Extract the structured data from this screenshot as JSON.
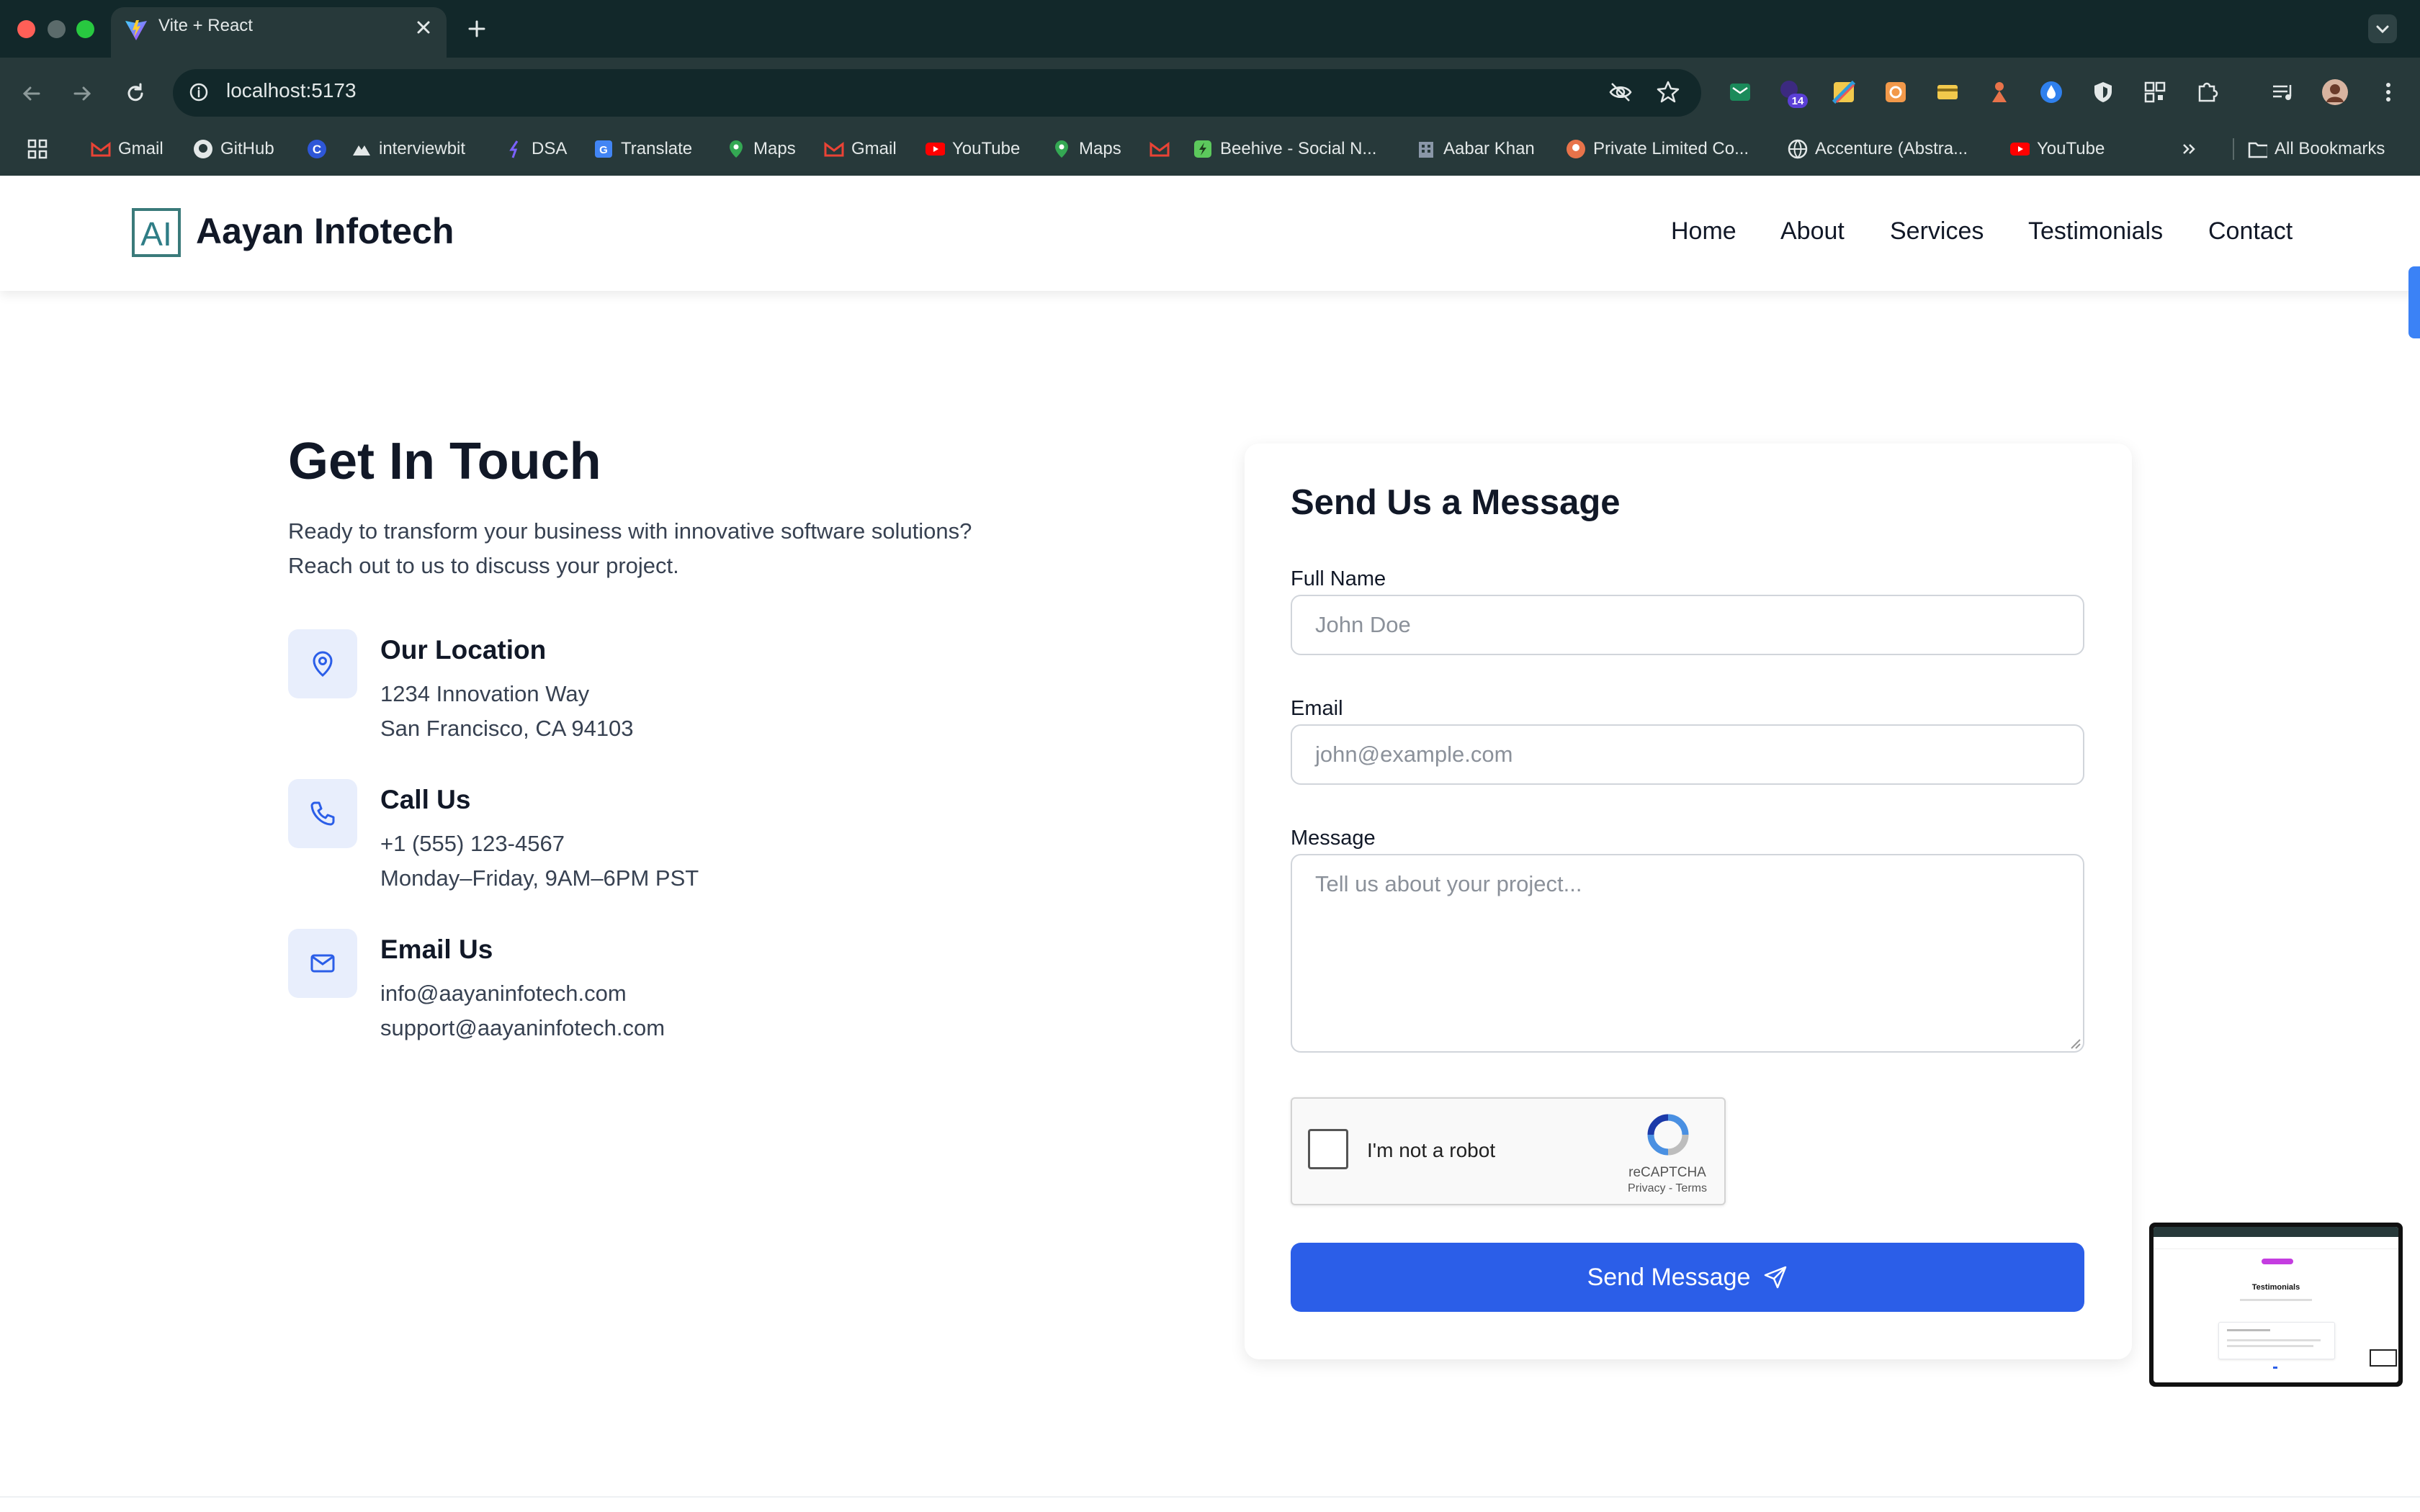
{
  "browser": {
    "tab_title": "Vite + React",
    "url": "localhost:5173",
    "extension_badge": "14",
    "bookmarks": [
      "Gmail",
      "GitHub",
      "interviewbit",
      "DSA",
      "Translate",
      "Maps",
      "Gmail",
      "YouTube",
      "Maps",
      "Beehive - Social N...",
      "Aabar Khan",
      "Private Limited Co...",
      "Accenture (Abstra...",
      "YouTube"
    ],
    "all_bookmarks": "All Bookmarks"
  },
  "site": {
    "logo_mark": "AI",
    "brand": "Aayan Infotech",
    "nav": [
      "Home",
      "About",
      "Services",
      "Testimonials",
      "Contact"
    ]
  },
  "contact": {
    "title": "Get In Touch",
    "intro_line1": "Ready to transform your business with innovative software solutions?",
    "intro_line2": "Reach out to us to discuss your project.",
    "items": [
      {
        "icon": "map-pin-icon",
        "title": "Our Location",
        "line1": "1234 Innovation Way",
        "line2": "San Francisco, CA 94103"
      },
      {
        "icon": "phone-icon",
        "title": "Call Us",
        "line1": "+1 (555) 123-4567",
        "line2": "Monday–Friday, 9AM–6PM PST"
      },
      {
        "icon": "mail-icon",
        "title": "Email Us",
        "line1": "info@aayaninfotech.com",
        "line2": "support@aayaninfotech.com"
      }
    ]
  },
  "form": {
    "title": "Send Us a Message",
    "name_label": "Full Name",
    "name_placeholder": "John Doe",
    "email_label": "Email",
    "email_placeholder": "john@example.com",
    "message_label": "Message",
    "message_placeholder": "Tell us about your project...",
    "recaptcha_label": "I'm not a robot",
    "recaptcha_brand": "reCAPTCHA",
    "recaptcha_links": "Privacy - Terms",
    "submit_label": "Send Message"
  },
  "thumbnail": {
    "heading": "Testimonials"
  },
  "colors": {
    "accent": "#2b5ee8",
    "icon_bg": "#e8eefc",
    "chrome_dark": "#12282a",
    "chrome": "#27393a"
  }
}
